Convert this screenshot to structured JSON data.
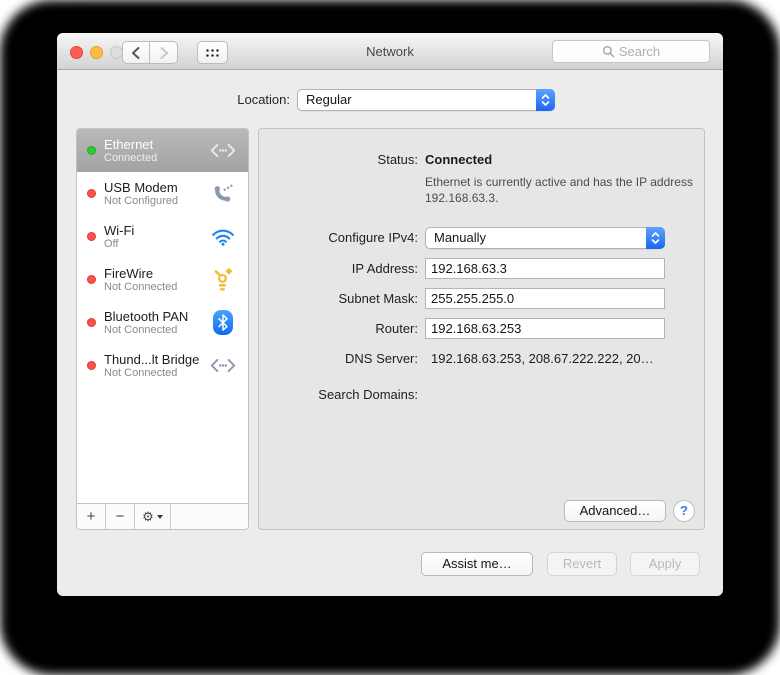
{
  "window": {
    "title": "Network"
  },
  "toolbar": {
    "search_placeholder": "Search"
  },
  "location": {
    "label": "Location:",
    "value": "Regular"
  },
  "sidebar": {
    "items": [
      {
        "name": "Ethernet",
        "status": "Connected"
      },
      {
        "name": "USB Modem",
        "status": "Not Configured"
      },
      {
        "name": "Wi-Fi",
        "status": "Off"
      },
      {
        "name": "FireWire",
        "status": "Not Connected"
      },
      {
        "name": "Bluetooth PAN",
        "status": "Not Connected"
      },
      {
        "name": "Thund...lt Bridge",
        "status": "Not Connected"
      }
    ],
    "add_label": "+",
    "remove_label": "−"
  },
  "main": {
    "status": {
      "label": "Status:",
      "value": "Connected",
      "description": "Ethernet is currently active and has the IP address 192.168.63.3."
    },
    "configure_ipv4": {
      "label": "Configure IPv4:",
      "value": "Manually"
    },
    "ip_address": {
      "label": "IP Address:",
      "value": "192.168.63.3"
    },
    "subnet_mask": {
      "label": "Subnet Mask:",
      "value": "255.255.255.0"
    },
    "router": {
      "label": "Router:",
      "value": "192.168.63.253"
    },
    "dns_server": {
      "label": "DNS Server:",
      "value": "192.168.63.253, 208.67.222.222, 20…"
    },
    "search_domains": {
      "label": "Search Domains:",
      "value": ""
    },
    "advanced_label": "Advanced…",
    "help_label": "?"
  },
  "footer": {
    "assist_label": "Assist me…",
    "revert_label": "Revert",
    "apply_label": "Apply"
  },
  "colors": {
    "accent_blue": "#2f7cf6",
    "status_green": "#2fcb30",
    "status_red": "#fc524a",
    "selected_row_gray": "#aaaaaa"
  }
}
